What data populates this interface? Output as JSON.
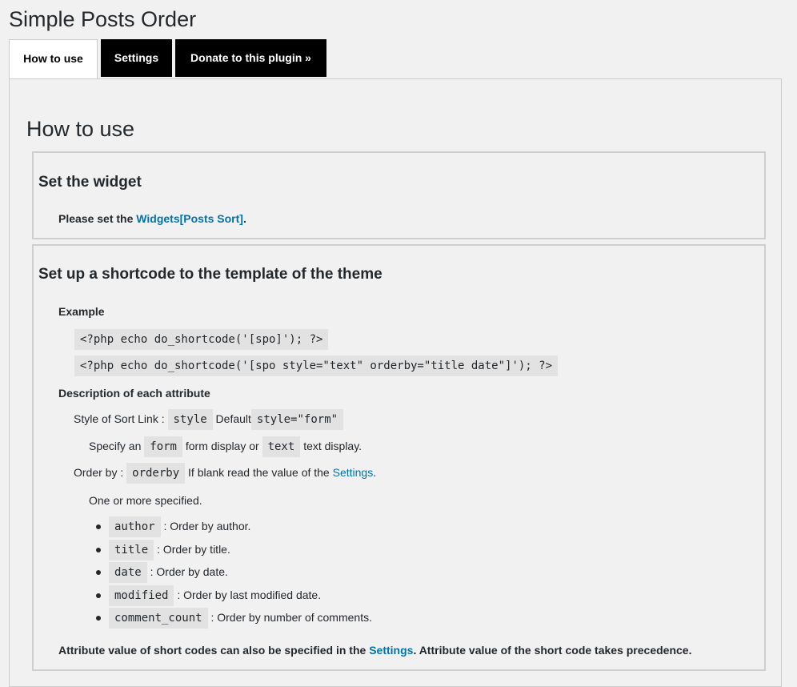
{
  "page": {
    "title": "Simple Posts Order"
  },
  "tabs": [
    {
      "label": "How to use"
    },
    {
      "label": "Settings"
    },
    {
      "label": "Donate to this plugin »"
    }
  ],
  "howto": {
    "title": "How to use",
    "widget": {
      "heading": "Set the widget",
      "text_before": "Please set the ",
      "link": "Widgets[Posts Sort]",
      "text_after": "."
    },
    "shortcode": {
      "heading": "Set up a shortcode to the template of the theme",
      "example_label": "Example",
      "example_1": "<?php echo do_shortcode('[spo]'); ?>",
      "example_2": "<?php echo do_shortcode('[spo style=\"text\" orderby=\"title date\"]'); ?>",
      "desc_label": "Description of each attribute",
      "style_label": "Style of Sort Link :",
      "style_code": "style",
      "default_label": "Default",
      "style_default_code": "style=\"form\"",
      "specify_an": "Specify an",
      "form_code": "form",
      "form_display": "form display or",
      "text_code": "text",
      "text_display": "text display.",
      "orderby_label": "Order by :",
      "orderby_code": "orderby",
      "orderby_blank": "If blank read the value of the",
      "settings_link": "Settings",
      "period": ".",
      "one_or_more": "One or more specified.",
      "options": [
        {
          "code": "author",
          "desc": ": Order by author."
        },
        {
          "code": "title",
          "desc": ": Order by title."
        },
        {
          "code": "date",
          "desc": ": Order by date."
        },
        {
          "code": "modified",
          "desc": ": Order by last modified date."
        },
        {
          "code": "comment_count",
          "desc": ": Order by number of comments."
        }
      ],
      "footer_before": "Attribute value of short codes can also be specified in the ",
      "footer_link": "Settings",
      "footer_after": ". Attribute value of the short code takes precedence."
    }
  }
}
